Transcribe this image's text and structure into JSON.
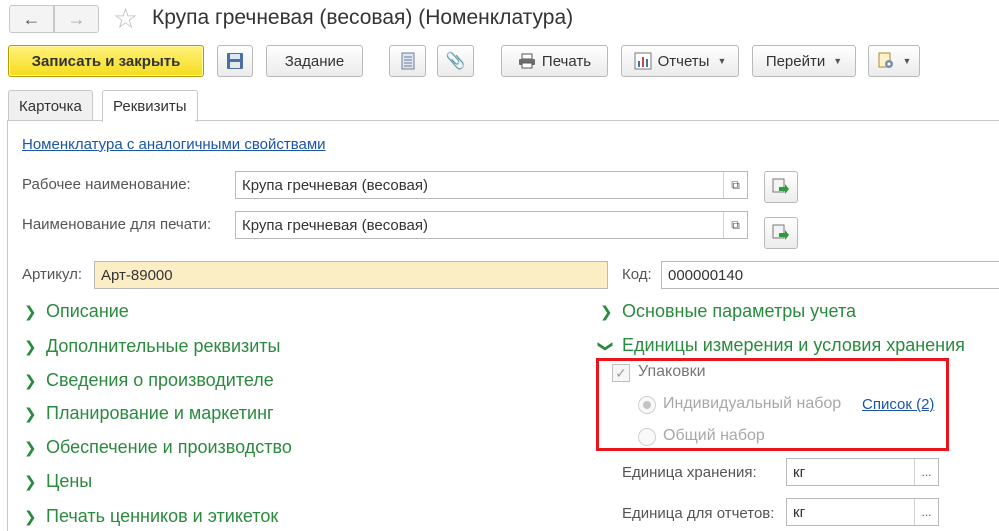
{
  "window": {
    "title": "Крупа гречневая (весовая) (Номенклатура)"
  },
  "toolbar": {
    "save_close_label": "Записать и закрыть",
    "task_label": "Задание",
    "print_label": "Печать",
    "reports_label": "Отчеты",
    "goto_label": "Перейти"
  },
  "tabs": [
    {
      "label": "Карточка",
      "active": false
    },
    {
      "label": "Реквизиты",
      "active": true
    }
  ],
  "form": {
    "similar_link": "Номенклатура с аналогичными свойствами",
    "working_name_label": "Рабочее наименование:",
    "working_name_value": "Крупа гречневая (весовая)",
    "print_name_label": "Наименование для печати:",
    "print_name_value": "Крупа гречневая (весовая)",
    "article_label": "Артикул:",
    "article_value": "Арт-89000",
    "code_label": "Код:",
    "code_value": "000000140"
  },
  "left_groups": [
    "Описание",
    "Дополнительные реквизиты",
    "Сведения о производителе",
    "Планирование и маркетинг",
    "Обеспечение и производство",
    "Цены",
    "Печать ценников и этикеток"
  ],
  "right_groups": {
    "accounting_params": "Основные параметры учета",
    "units_storage": "Единицы измерения и условия хранения"
  },
  "packaging": {
    "checkbox_label": "Упаковки",
    "checked": true,
    "individual_label": "Индивидуальный набор",
    "list_link": "Список (2)",
    "common_label": "Общий набор",
    "selected": "individual"
  },
  "units": {
    "storage_label": "Единица хранения:",
    "storage_value": "кг",
    "reports_label": "Единица для отчетов:",
    "reports_value": "кг"
  },
  "colors": {
    "accent_yellow": "#f5dc1e",
    "group_green": "#2a8a3e",
    "link_blue": "#1a55a8",
    "highlight_red": "#e8161b"
  }
}
